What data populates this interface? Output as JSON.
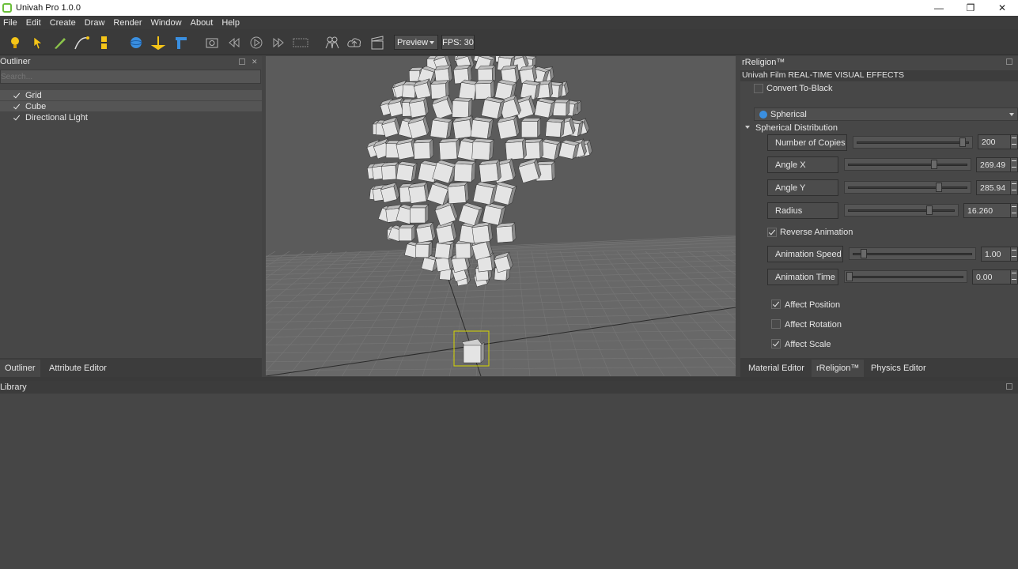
{
  "window": {
    "title": "Univah Pro 1.0.0",
    "minimize": "—",
    "maximize": "❐",
    "close": "✕"
  },
  "menu": [
    "File",
    "Edit",
    "Create",
    "Draw",
    "Render",
    "Window",
    "About",
    "Help"
  ],
  "toolbar": {
    "icons": [
      "light-bulb-icon",
      "select-arrow-icon",
      "pencil-icon",
      "curve-icon",
      "measure-icon",
      "sphere-icon",
      "pivot-icon",
      "wall-icon",
      "camera-icon",
      "rewind-icon",
      "play-icon",
      "fast-forward-icon",
      "record-icon",
      "people-icon",
      "cloud-upload-icon",
      "clapper-icon"
    ],
    "preview_label": "Preview",
    "fps_label": "FPS: 30"
  },
  "outliner": {
    "title": "Outliner",
    "search_placeholder": "Search...",
    "items": [
      {
        "label": "Grid",
        "checked": true,
        "selected": true
      },
      {
        "label": "Cube",
        "checked": true,
        "selected": true
      },
      {
        "label": "Directional Light",
        "checked": true,
        "selected": false
      }
    ],
    "tabs": [
      "Outliner",
      "Attribute Editor"
    ]
  },
  "rpanel": {
    "title": "rReligion™",
    "subtitle": "Univah Film REAL-TIME VISUAL EFFECTS",
    "convert_to_black": {
      "label": "Convert To-Black",
      "checked": false
    },
    "distribution": "Spherical",
    "section_title": "Spherical Distribution",
    "params": [
      {
        "label": "Number of Copies",
        "value": "200",
        "position": 0.97
      },
      {
        "label": "Angle X",
        "value": "269.49",
        "position": 0.74
      },
      {
        "label": "Angle Y",
        "value": "285.94",
        "position": 0.78
      },
      {
        "label": "Radius",
        "value": "16.260",
        "position": 0.78
      },
      {
        "label": "Animation Speed",
        "value": "1.00",
        "position": 0.08
      },
      {
        "label": "Animation Time",
        "value": "0.00",
        "position": 0.0
      }
    ],
    "reverse_animation": {
      "label": "Reverse Animation",
      "checked": true
    },
    "affect_position": {
      "label": "Affect Position",
      "checked": true
    },
    "affect_rotation": {
      "label": "Affect Rotation",
      "checked": false
    },
    "affect_scale": {
      "label": "Affect Scale",
      "checked": true
    },
    "tabs": [
      "Material Editor",
      "rReligion™",
      "Physics Editor"
    ]
  },
  "library": {
    "title": "Library"
  },
  "colors": {
    "accent": "#3a8fe0",
    "logo": "#6bbf3a",
    "selection": "#d6d600"
  }
}
